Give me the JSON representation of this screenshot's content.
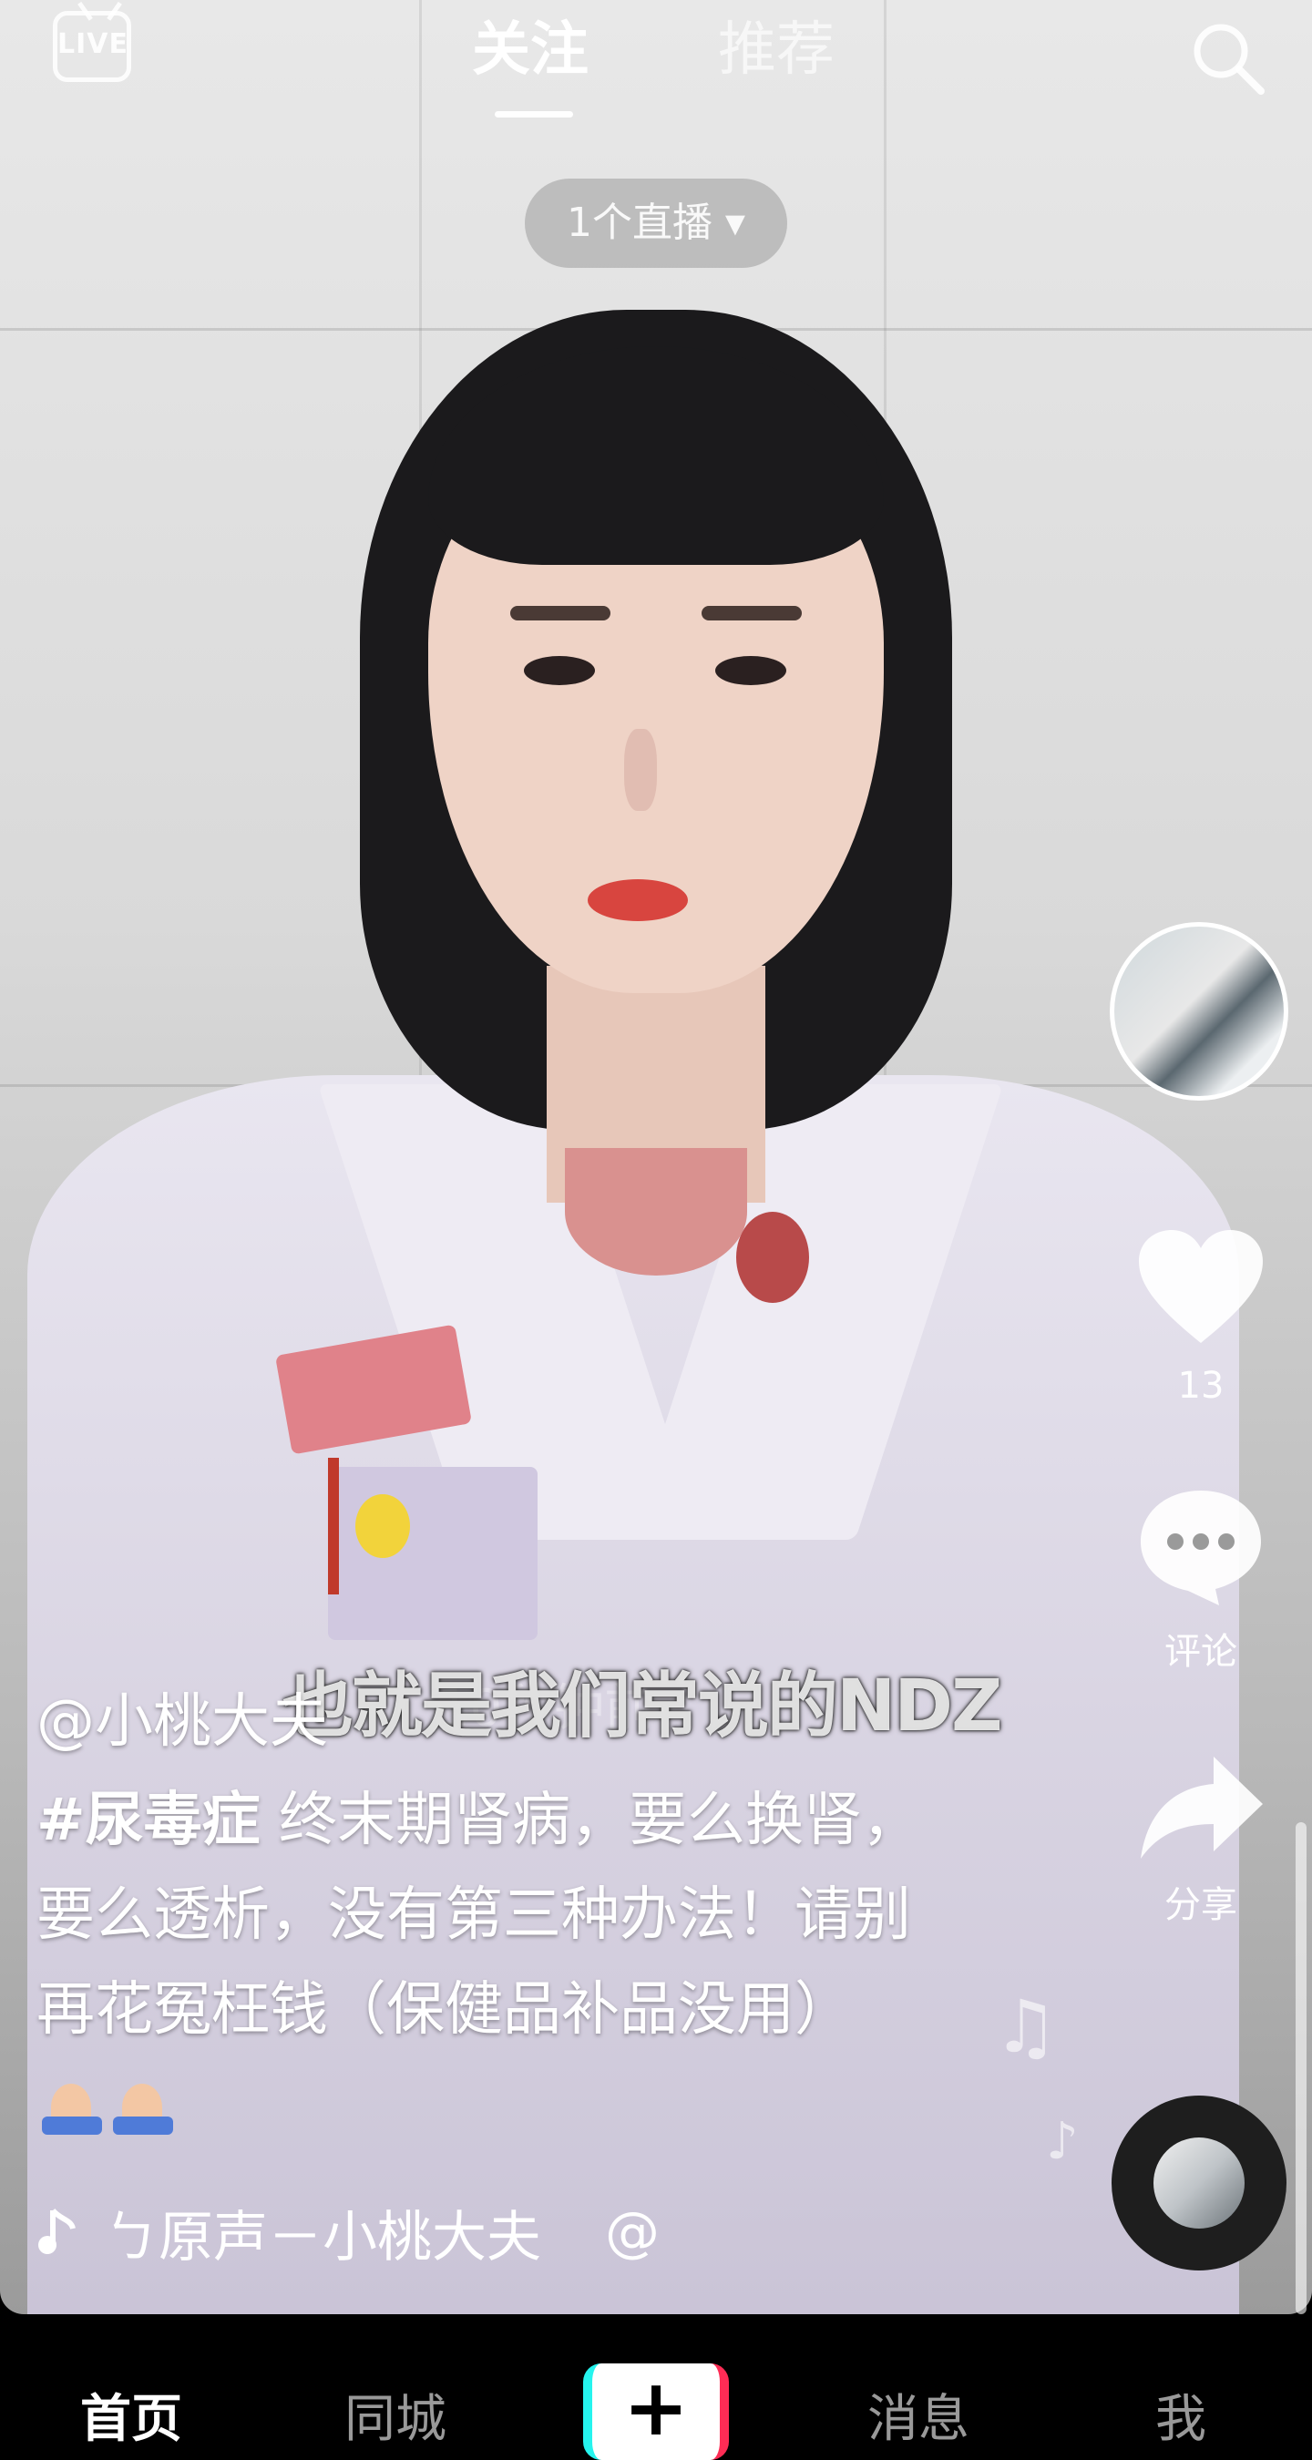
{
  "top_bar": {
    "live_label": "LIVE",
    "tabs": [
      {
        "label": "关注",
        "active": true
      },
      {
        "label": "推荐",
        "active": false
      }
    ],
    "live_dropdown": "1个直播 ▾"
  },
  "video": {
    "subtitle": "也就是我们常说的NDZ",
    "overlay_faint": "10秒钟前"
  },
  "sidebar": {
    "like_count": "13",
    "comment_label": "评论",
    "share_label": "分享"
  },
  "caption": {
    "author": "@小桃大夫",
    "hashtag": "#尿毒症",
    "text": " 终末期肾病，要么换肾，要么透析，没有第三种办法！请别再花冤枉钱（保健品补品没用）",
    "music": "ㄅ原声－小桃大夫",
    "music_at": "@"
  },
  "bottom_nav": {
    "items": [
      "首页",
      "同城",
      "+",
      "消息",
      "我"
    ],
    "active": "首页"
  },
  "colors": {
    "nav_bg": "#000000",
    "accent_cyan": "#25f4ee",
    "accent_red": "#fe2c55"
  },
  "icons": [
    "live-icon",
    "search-icon",
    "heart-icon",
    "comment-icon",
    "share-icon",
    "music-note-icon",
    "music-disc-icon",
    "plus-icon"
  ]
}
